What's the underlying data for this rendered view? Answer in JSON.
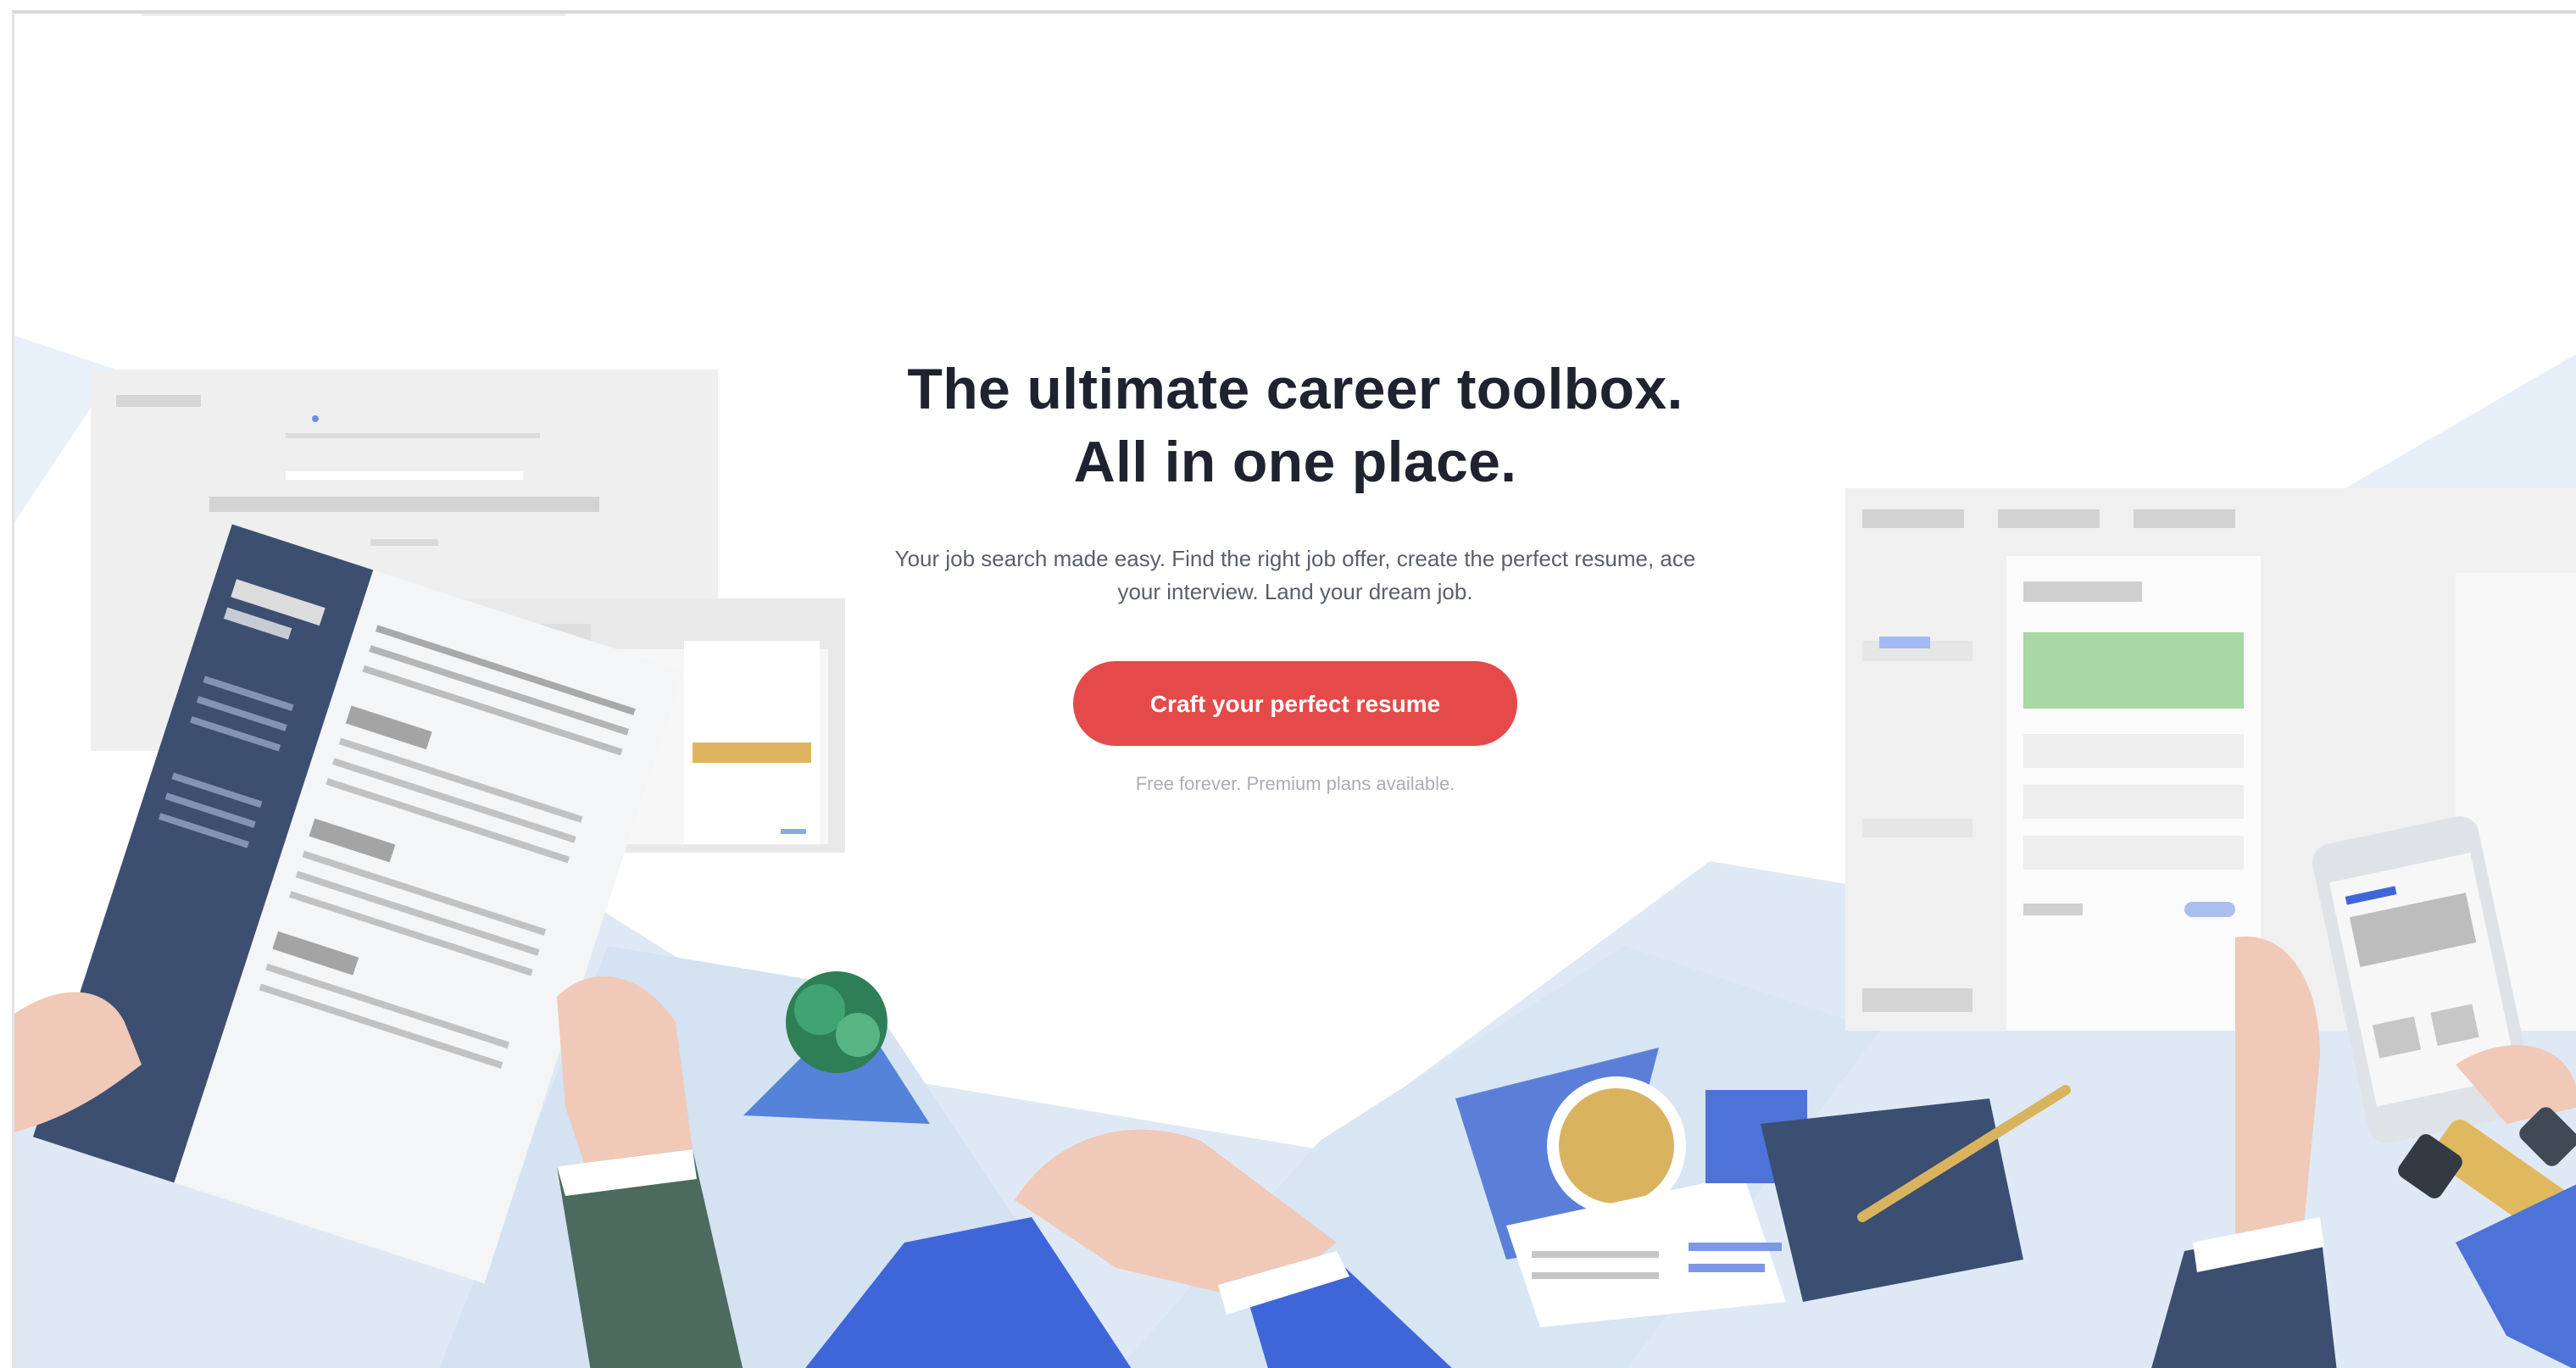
{
  "hero": {
    "headline_line1": "The ultimate career toolbox.",
    "headline_line2": "All in one place.",
    "description": "Your job search made easy. Find the right job offer, create the perfect resume, ace your interview. Land your dream job.",
    "cta_label": "Craft your perfect resume",
    "footnote": "Free forever. Premium plans available."
  },
  "colors": {
    "cta": "#e54a4a",
    "headline": "#1f2330",
    "accent_blue": "#3f66d9",
    "resume_navy": "#3d4f70"
  },
  "illustration": {
    "icons": [
      "resume-document-icon",
      "monitor-icon",
      "tablet-icon",
      "plant-icon",
      "smartphone-icon",
      "coffee-cup-icon",
      "pen-icon",
      "highlighter-icon"
    ]
  }
}
